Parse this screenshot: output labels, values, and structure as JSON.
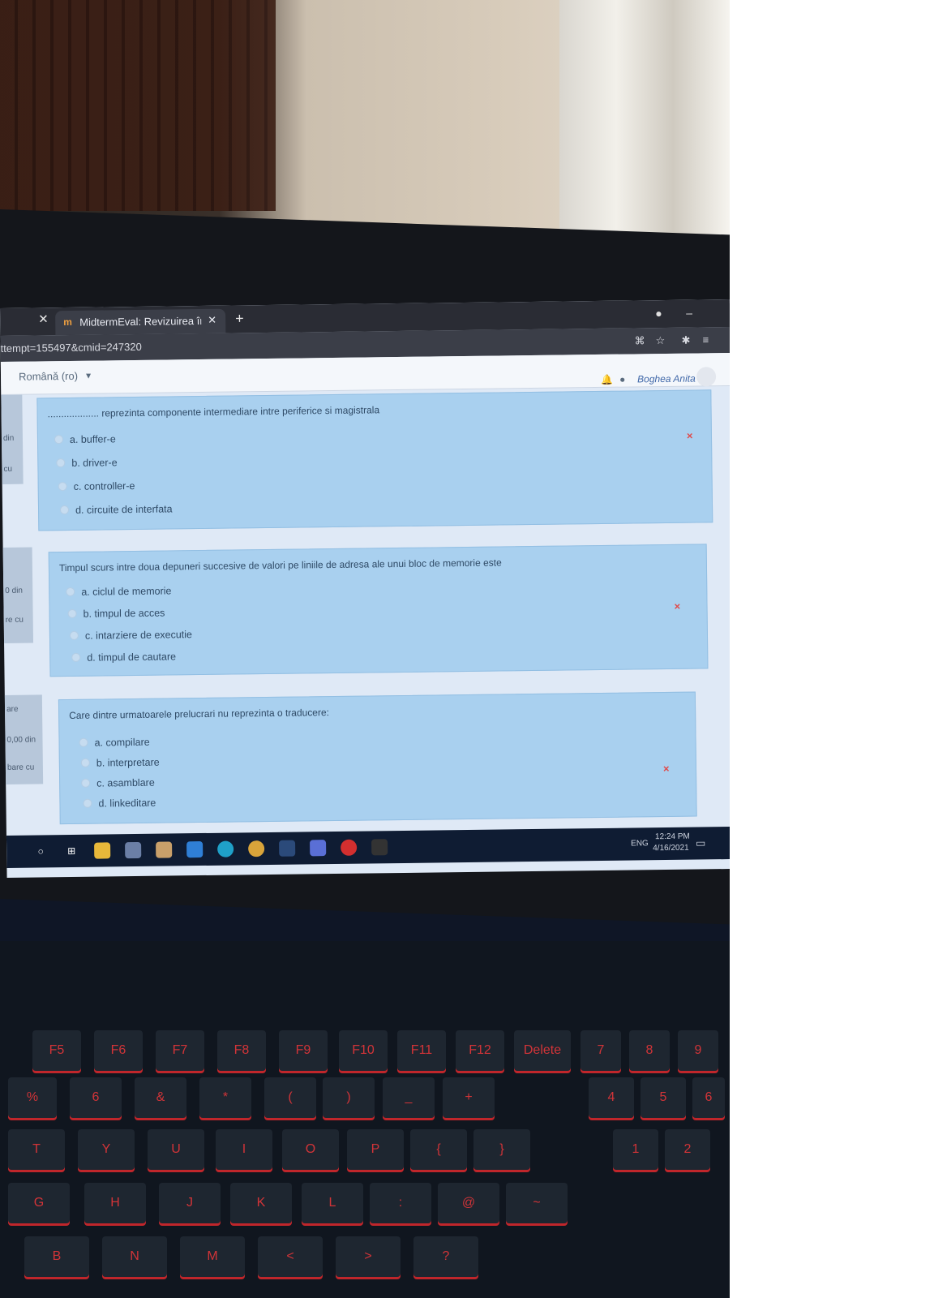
{
  "browser": {
    "tab_title": "MidtermEval: Revizuirea încercări",
    "tab_favicon": "m",
    "url": "ttempt=155497&cmid=247320"
  },
  "site": {
    "language": "Română (ro)",
    "user_name": "Boghea Anita"
  },
  "sidebar_info": [
    {
      "lines": [
        "din",
        "cu"
      ]
    },
    {
      "lines": [
        "0 din",
        "re cu"
      ]
    },
    {
      "lines": [
        "are",
        "0,00 din",
        "bare cu"
      ]
    }
  ],
  "questions": [
    {
      "text": "................... reprezinta componente intermediare intre periferice si magistrala",
      "answers": [
        "a. buffer-e",
        "b. driver-e",
        "c. controller-e",
        "d. circuite de interfata"
      ],
      "result_icon": "×"
    },
    {
      "text": "Timpul scurs intre doua depuneri succesive de valori pe liniile de adresa ale unui bloc de memorie este",
      "answers": [
        "a. ciclul de memorie",
        "b. timpul de acces",
        "c. intarziere de executie",
        "d. timpul de cautare"
      ],
      "result_icon": "×"
    },
    {
      "text": "Care dintre urmatoarele prelucrari nu reprezinta o traducere:",
      "answers": [
        "a. compilare",
        "b. interpretare",
        "c. asamblare",
        "d. linkeditare"
      ],
      "result_icon": "×"
    }
  ],
  "taskbar": {
    "time": "12:24 PM",
    "date": "4/16/2021",
    "lang": "ENG"
  },
  "keyboard": {
    "fn_row": [
      "F5",
      "F6",
      "F7",
      "F8",
      "F9",
      "F10",
      "F11",
      "F12",
      "Delete",
      "7",
      "8",
      "9"
    ],
    "num_row": [
      "%",
      "6",
      "&",
      "*",
      "(",
      ")",
      "_",
      "+",
      "4",
      "5",
      "6"
    ],
    "row_2": [
      "T",
      "Y",
      "U",
      "I",
      "O",
      "P",
      "{",
      "}",
      "1",
      "2"
    ],
    "row_3": [
      "G",
      "H",
      "J",
      "K",
      "L",
      ":",
      "@",
      "~"
    ],
    "row_4": [
      "B",
      "N",
      "M",
      "<",
      ">",
      "?"
    ]
  },
  "colors": {
    "question_bg": "#a9d0ef",
    "wrong_mark": "#e04a4a",
    "key_glow": "#c0262b"
  }
}
